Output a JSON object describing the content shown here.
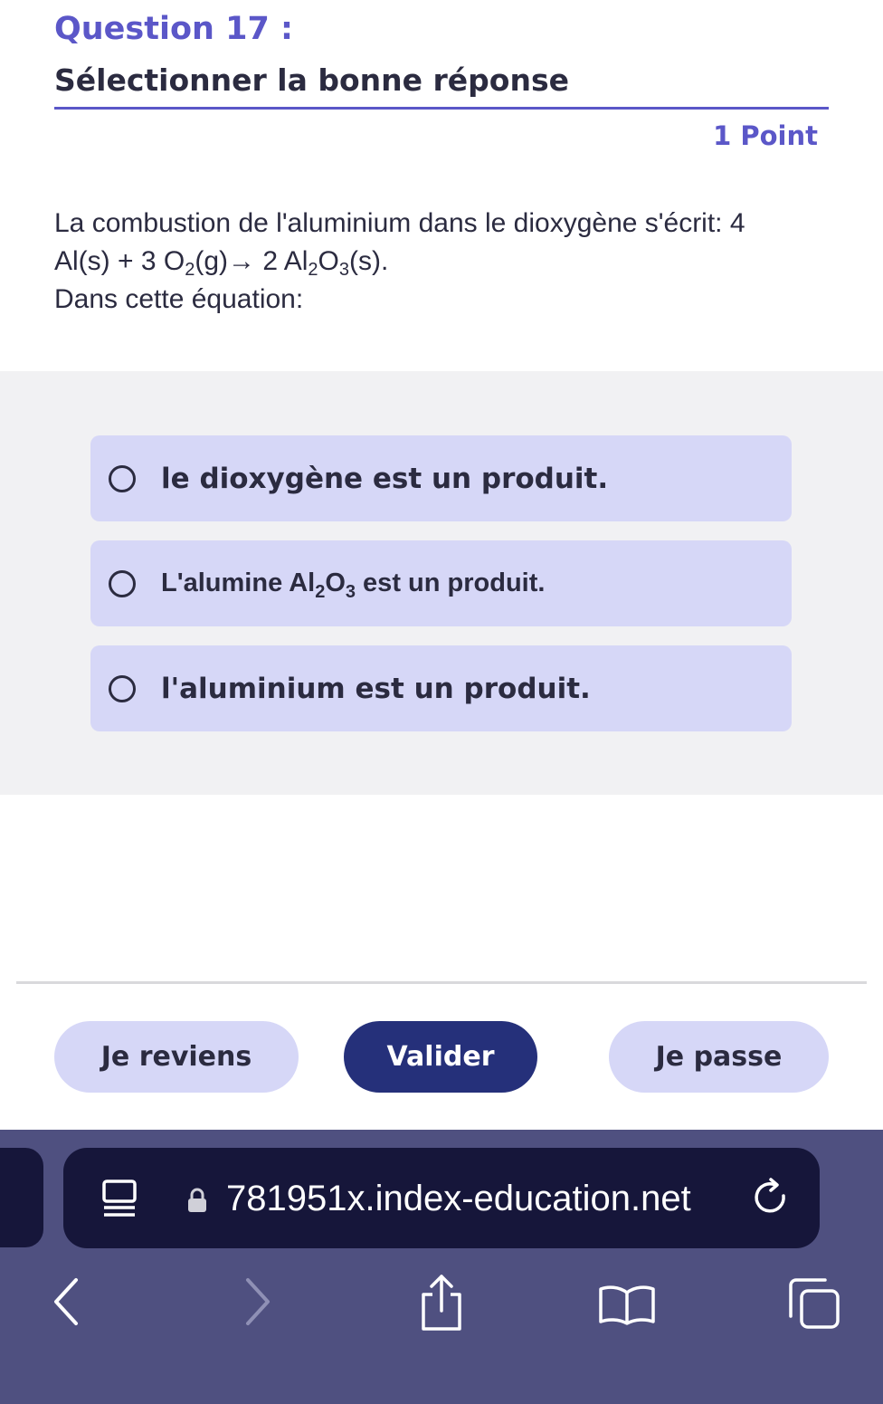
{
  "question": {
    "number": "Question 17 :",
    "instruction": "Sélectionner la bonne réponse",
    "points": "1 Point",
    "text_line1": "La combustion de l'aluminium dans le dioxygène s'écrit: 4",
    "eq_a": "Al(s) + 3 O",
    "eq_sub1": "2",
    "eq_b": "(g)→ 2 Al",
    "eq_sub2": "2",
    "eq_c": "O",
    "eq_sub3": "3",
    "eq_d": "(s).",
    "text_line3": "Dans cette équation:"
  },
  "options": [
    {
      "label": "le dioxygène est un produit."
    },
    {
      "label_a": "L'alumine ",
      "label_b": "Al",
      "sub1": "2",
      "label_c": "O",
      "sub2": "3",
      "label_d": " est un produit."
    },
    {
      "label": "l'aluminium est un produit."
    }
  ],
  "buttons": {
    "back": "Je reviens",
    "validate": "Valider",
    "skip": "Je passe"
  },
  "browser": {
    "url": "781951x.index-education.net"
  },
  "colors": {
    "accent": "#5b57c8",
    "option_bg": "#d6d7f7",
    "primary_button": "#25307a",
    "browser_bar": "#4f5080"
  },
  "icons": [
    "reader-icon",
    "lock-icon",
    "reload-icon",
    "back-icon",
    "forward-icon",
    "share-icon",
    "bookmarks-icon",
    "tabs-icon"
  ]
}
